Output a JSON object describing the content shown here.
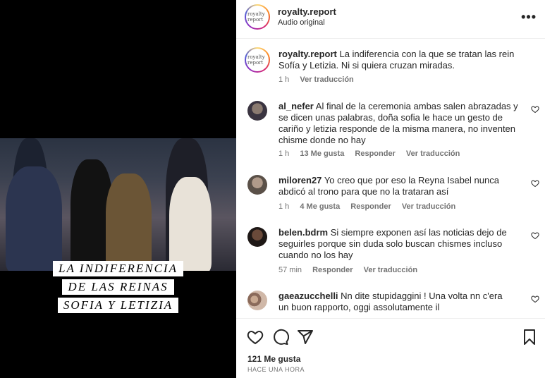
{
  "video": {
    "overlay_lines": [
      "LA INDIFERENCIA",
      "DE LAS REINAS",
      "SOFIA Y LETIZIA"
    ]
  },
  "post": {
    "username": "royalty.report",
    "audio": "Audio original",
    "logo_text": "royalty report",
    "more_icon": "•••"
  },
  "caption": {
    "username": "royalty.report",
    "text": "La indiferencia con la que se tratan las rein Sofía y Letizia. Ni si quiera cruzan miradas.",
    "time": "1 h",
    "translate": "Ver traducción"
  },
  "comments": [
    {
      "username": "al_nefer",
      "text": "Al final de la ceremonia ambas salen abrazadas y se dicen unas palabras, doña sofia le hace un gesto de cariño y letizia responde de la misma manera, no inventen chisme donde no hay",
      "time": "1 h",
      "likes": "13 Me gusta",
      "reply": "Responder",
      "translate": "Ver traducción"
    },
    {
      "username": "miloren27",
      "text": "Yo creo que por eso la Reyna Isabel nunca abdicó al trono para que no la trataran así",
      "time": "1 h",
      "likes": "4 Me gusta",
      "reply": "Responder",
      "translate": "Ver traducción"
    },
    {
      "username": "belen.bdrm",
      "text": "Si siempre exponen así las noticias dejo de seguirles porque sin duda solo buscan chismes incluso cuando no los hay",
      "time": "57 min",
      "likes": "",
      "reply": "Responder",
      "translate": "Ver traducción"
    },
    {
      "username": "gaeazucchelli",
      "text": "Nn dite stupidaggini ! Una volta nn c'era un buon rapporto, oggi assolutamente il",
      "time": "",
      "likes": "",
      "reply": "",
      "translate": ""
    }
  ],
  "actions": {
    "likes": "121 Me gusta",
    "timestamp": "HACE UNA HORA",
    "icons": [
      "heart-icon",
      "comment-icon",
      "share-icon",
      "save-icon"
    ]
  },
  "colors": {
    "text": "#262626",
    "muted": "#737373",
    "border": "#efefef"
  }
}
